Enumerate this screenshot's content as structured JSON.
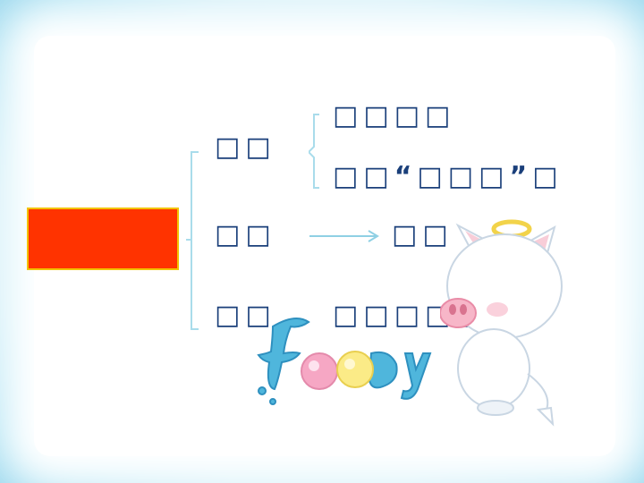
{
  "slide": {
    "title_box_color": "#ff3300",
    "title_box_border": "#f2c200",
    "text_color": "#1a3f7a"
  },
  "outline": {
    "branch1": {
      "label": "□□",
      "sub1": "□□□□",
      "sub2_pre": "□□",
      "sub2_quote_open": "“",
      "sub2_quoted": "□□□",
      "sub2_quote_close": "”",
      "sub2_post": "□"
    },
    "branch2": {
      "label": "□□",
      "target": "□□"
    },
    "branch3": {
      "label": "□□",
      "detail": "□□□□□"
    }
  },
  "decor": {
    "logo_text": "Fooby",
    "mascot": "cartoon-white-pig"
  }
}
